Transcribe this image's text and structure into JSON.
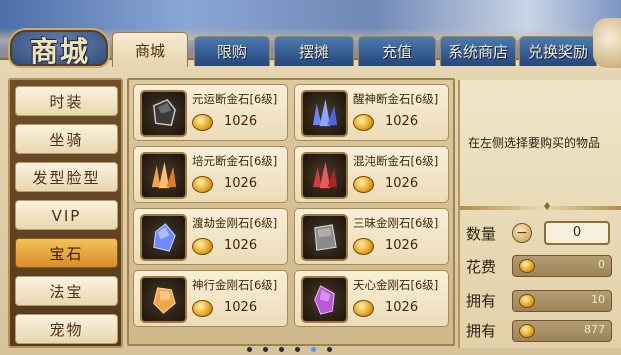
{
  "logo": {
    "text": "商城"
  },
  "tabs": [
    {
      "label": "商城",
      "active": true
    },
    {
      "label": "限购",
      "active": false
    },
    {
      "label": "摆摊",
      "active": false
    },
    {
      "label": "充值",
      "active": false
    },
    {
      "label": "系统商店",
      "active": false
    },
    {
      "label": "兑换奖励",
      "active": false
    }
  ],
  "categories": [
    {
      "label": "时装",
      "active": false
    },
    {
      "label": "坐骑",
      "active": false
    },
    {
      "label": "发型脸型",
      "active": false
    },
    {
      "label": "VIP",
      "active": false
    },
    {
      "label": "宝石",
      "active": true
    },
    {
      "label": "法宝",
      "active": false
    },
    {
      "label": "宠物",
      "active": false
    }
  ],
  "items": [
    {
      "name": "元运断金石[6级]",
      "price": "1026",
      "icon": "dark-stone-icon",
      "color": "#2b2b2b"
    },
    {
      "name": "醒神断金石[6级]",
      "price": "1026",
      "icon": "blue-crystal-cluster-icon",
      "color": "#5f7cff"
    },
    {
      "name": "培元断金石[6级]",
      "price": "1026",
      "icon": "orange-crystal-cluster-icon",
      "color": "#f39a3a"
    },
    {
      "name": "混沌断金石[6级]",
      "price": "1026",
      "icon": "red-crystal-cluster-icon",
      "color": "#d43a3a"
    },
    {
      "name": "渡劫金刚石[6级]",
      "price": "1026",
      "icon": "blue-gem-icon",
      "color": "#6f8cff"
    },
    {
      "name": "三昧金刚石[6级]",
      "price": "1026",
      "icon": "grey-stone-icon",
      "color": "#8a8a8a"
    },
    {
      "name": "神行金刚石[6级]",
      "price": "1026",
      "icon": "orange-gem-icon",
      "color": "#f0a64a"
    },
    {
      "name": "天心金刚石[6级]",
      "price": "1026",
      "icon": "purple-gem-icon",
      "color": "#b65ad8"
    }
  ],
  "detail": {
    "hint": "在左侧选择要购买的物品",
    "quantity_label": "数量",
    "quantity_value": "0",
    "cost_label": "花费",
    "cost_value": "0",
    "own_label_1": "拥有",
    "own_value_1": "10",
    "own_label_2": "拥有",
    "own_value_2": "877"
  },
  "pager": {
    "pages": 6,
    "current": 5
  }
}
